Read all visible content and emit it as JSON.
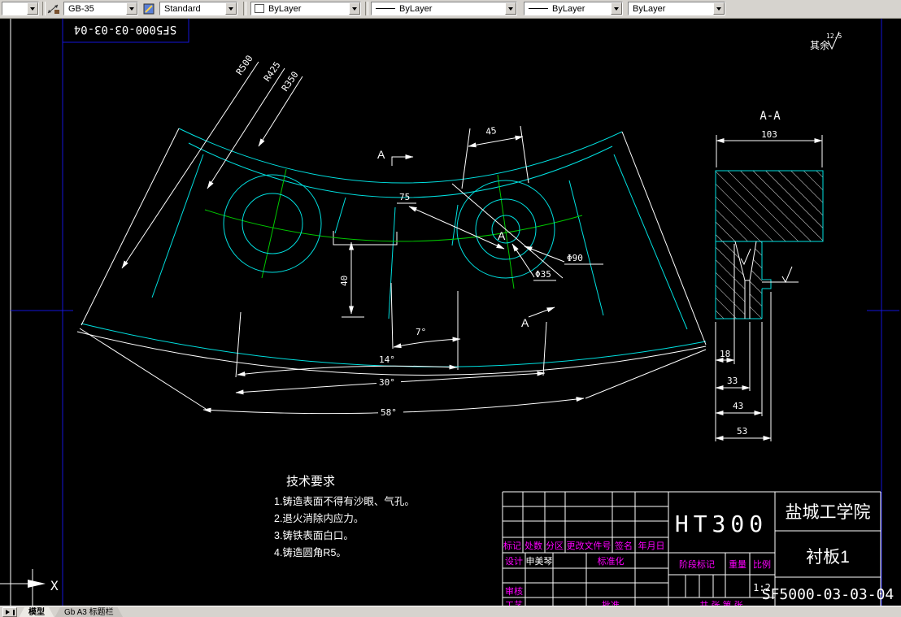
{
  "toolbar": {
    "dim_style_value": "GB-35",
    "text_style_value": "Standard",
    "color_value": "ByLayer",
    "linetype_value": "ByLayer",
    "lineweight_value": "ByLayer",
    "plot_style_value": "ByLayer"
  },
  "frame": {
    "inverted_title": "SF5000-03-03-04",
    "surface_note": "其余",
    "surface_roughness": "12.5"
  },
  "drawing": {
    "r1": "R500",
    "r2": "R425",
    "r3": "R350",
    "d45": "45",
    "d75": "75",
    "d40": "40",
    "a7": "7°",
    "a14": "14°",
    "a30": "30°",
    "a58": "58°",
    "dia90": "Φ90",
    "dia35": "Φ35",
    "section_letter": "A",
    "section_title": "A-A",
    "d103": "103",
    "d18": "18",
    "d33": "33",
    "d43": "43",
    "d53": "53",
    "ucs_x": "X"
  },
  "tech_req": {
    "title": "技术要求",
    "items": [
      "1.铸造表面不得有沙眼、气孔。",
      "2.退火消除内应力。",
      "3.铸铁表面白口。",
      "4.铸造圆角R5。"
    ]
  },
  "title_block": {
    "revision_headers": [
      "标记",
      "处数",
      "分区",
      "更改文件号",
      "签名",
      "年月日"
    ],
    "design_label": "设计",
    "designer_name": "申美琴",
    "standardization_label": "标准化",
    "audit_label": "审核",
    "process_label": "工艺",
    "approve_label": "批准",
    "stage_label": "阶段标记",
    "weight_label": "重量",
    "scale_label": "比例",
    "scale_value": "1:2",
    "sheet_note": "共 张 第 张",
    "material": "HT300",
    "organization": "盐城工学院",
    "part_name": "衬板1",
    "drawing_number": "SF5000-03-03-04"
  },
  "tabs": {
    "model": "模型",
    "layout": "Gb A3 标题栏"
  },
  "colors": {
    "background": "#000000",
    "outline_cyan": "#00e0e0",
    "centerline_green": "#00c800",
    "frame_blue": "#0000cd",
    "annotation_magenta": "#ff00ff",
    "dim_white": "#ffffff",
    "ui_gray": "#d6d3ce"
  }
}
